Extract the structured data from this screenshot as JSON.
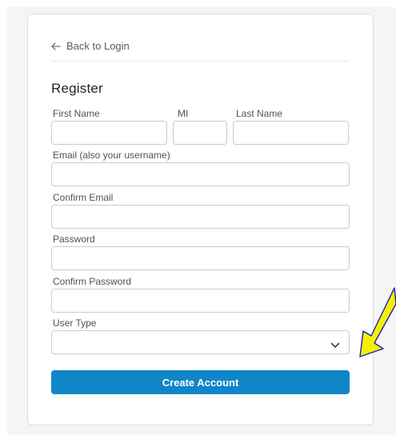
{
  "back_link": {
    "label": "Back to Login",
    "icon": "arrow-left-icon"
  },
  "form": {
    "title": "Register",
    "first_name": {
      "label": "First Name",
      "value": ""
    },
    "mi": {
      "label": "MI",
      "value": ""
    },
    "last_name": {
      "label": "Last Name",
      "value": ""
    },
    "email": {
      "label": "Email (also your username)",
      "value": ""
    },
    "confirm_email": {
      "label": "Confirm Email",
      "value": ""
    },
    "password": {
      "label": "Password",
      "value": ""
    },
    "confirm_password": {
      "label": "Confirm Password",
      "value": ""
    },
    "user_type": {
      "label": "User Type",
      "selected": "",
      "icon": "chevron-down-icon"
    },
    "submit_label": "Create Account"
  },
  "colors": {
    "primary_button": "#0f86c7",
    "annotation_arrow_fill": "#f5f000",
    "annotation_arrow_stroke": "#1a1fbf"
  }
}
